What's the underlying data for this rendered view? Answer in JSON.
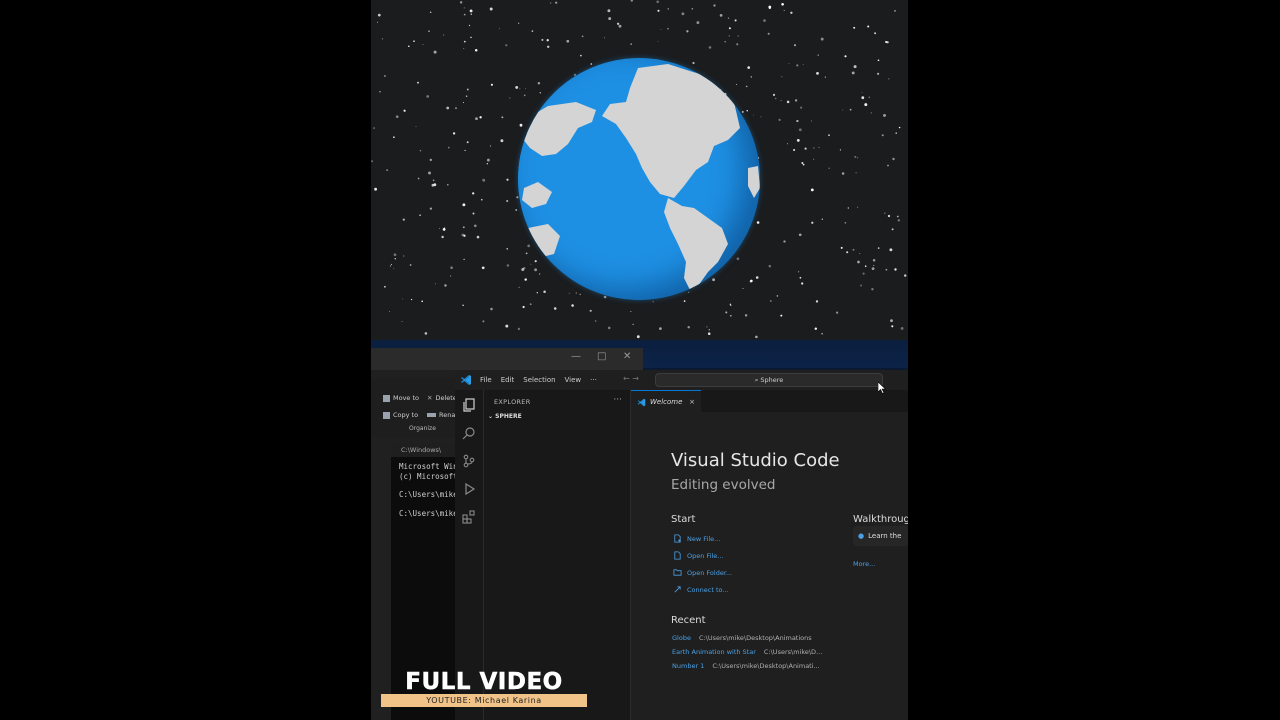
{
  "overlay": {
    "full_video": "FULL VIDEO",
    "youtube": "YOUTUBE: Michael Karina"
  },
  "explorer_window": {
    "ribbon": {
      "move_to": "Move to",
      "copy_to": "Copy to",
      "delete": "Delete",
      "rename": "Renam",
      "organize": "Organize"
    },
    "cmd_title": "C:\\Windows\\",
    "cmd_lines": [
      "Microsoft Wind",
      "(c) Microsoft",
      "C:\\Users\\mike",
      "C:\\Users\\mike"
    ]
  },
  "vscode": {
    "menu": [
      "File",
      "Edit",
      "Selection",
      "View"
    ],
    "menu_more": "···",
    "search_placeholder": "Sphere",
    "sidebar": {
      "title": "EXPLORER",
      "more": "···",
      "folder": "SPHERE"
    },
    "tab": {
      "label": "Welcome",
      "close": "×"
    },
    "welcome": {
      "title": "Visual Studio Code",
      "subtitle": "Editing evolved",
      "start_heading": "Start",
      "start_links": [
        "New File...",
        "Open File...",
        "Open Folder...",
        "Connect to..."
      ],
      "walkthroughs_heading": "Walkthroug",
      "walkthrough_item": "Learn the",
      "more_link": "More...",
      "recent_heading": "Recent",
      "recent": [
        {
          "name": "Globe",
          "path": "C:\\Users\\mike\\Desktop\\Animations"
        },
        {
          "name": "Earth Animation with Star",
          "path": "C:\\Users\\mike\\D..."
        },
        {
          "name": "Number 1",
          "path": "C:\\Users\\mike\\Desktop\\Animati..."
        }
      ]
    }
  },
  "colors": {
    "ocean": "#1e90e4",
    "land": "#d4d4d4",
    "vscode_accent": "#0078d4",
    "link": "#4aa0e6",
    "badge": "#f1c389"
  }
}
